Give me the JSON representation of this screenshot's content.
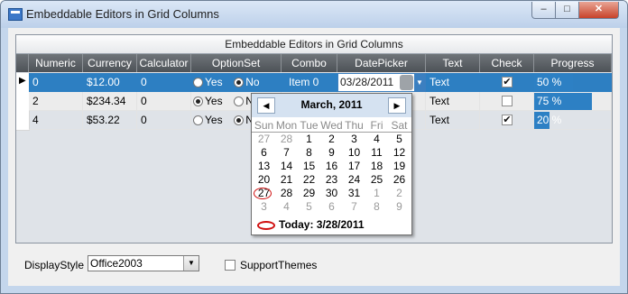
{
  "window": {
    "title": "Embeddable Editors in Grid Columns",
    "minimize_glyph": "‒",
    "maximize_glyph": "□",
    "close_glyph": "✕"
  },
  "grid": {
    "caption": "Embeddable Editors in Grid Columns",
    "columns": [
      "Numeric",
      "Currency",
      "Calculator",
      "OptionSet",
      "Combo",
      "DatePicker",
      "Text",
      "Check",
      "Progress"
    ],
    "rows": [
      {
        "numeric": "0",
        "currency": "$12.00",
        "calculator": "0",
        "yes_label": "Yes",
        "no_label": "No",
        "option_selected": "No",
        "combo": "Item 0",
        "date": "03/28/2011",
        "text": "Text",
        "checked": true,
        "progress_label": "50 %",
        "progress": 0.5
      },
      {
        "numeric": "2",
        "currency": "$234.34",
        "calculator": "0",
        "yes_label": "Yes",
        "no_label": "No",
        "option_selected": "Yes",
        "combo": "",
        "date": "",
        "text": "Text",
        "checked": false,
        "progress_label": "75 %",
        "progress": 0.75
      },
      {
        "numeric": "4",
        "currency": "$53.22",
        "calculator": "0",
        "yes_label": "Yes",
        "no_label": "No",
        "option_selected": "No",
        "combo": "",
        "date": "",
        "text": "Text",
        "checked": true,
        "progress_label": "20 %",
        "progress": 0.2
      }
    ],
    "current_row_glyph": "▶",
    "dropdown_glyph": "▼",
    "check_glyph": "✔"
  },
  "calendar": {
    "month_title": "March, 2011",
    "prev_glyph": "◀",
    "next_glyph": "▶",
    "days_of_week": [
      "Sun",
      "Mon",
      "Tue",
      "Wed",
      "Thu",
      "Fri",
      "Sat"
    ],
    "weeks": [
      [
        "27",
        "28",
        "1",
        "2",
        "3",
        "4",
        "5"
      ],
      [
        "6",
        "7",
        "8",
        "9",
        "10",
        "11",
        "12"
      ],
      [
        "13",
        "14",
        "15",
        "16",
        "17",
        "18",
        "19"
      ],
      [
        "20",
        "21",
        "22",
        "23",
        "24",
        "25",
        "26"
      ],
      [
        "27",
        "28",
        "29",
        "30",
        "31",
        "1",
        "2"
      ],
      [
        "3",
        "4",
        "5",
        "6",
        "7",
        "8",
        "9"
      ]
    ],
    "today_label": "Today: 3/28/2011"
  },
  "footer": {
    "display_style_label": "DisplayStyle",
    "display_style_value": "Office2003",
    "support_themes_label": "SupportThemes",
    "support_themes_checked": false
  },
  "colors": {
    "selection": "#2d7fc2",
    "header": "#5a5f64",
    "today_ring": "#d01010"
  }
}
